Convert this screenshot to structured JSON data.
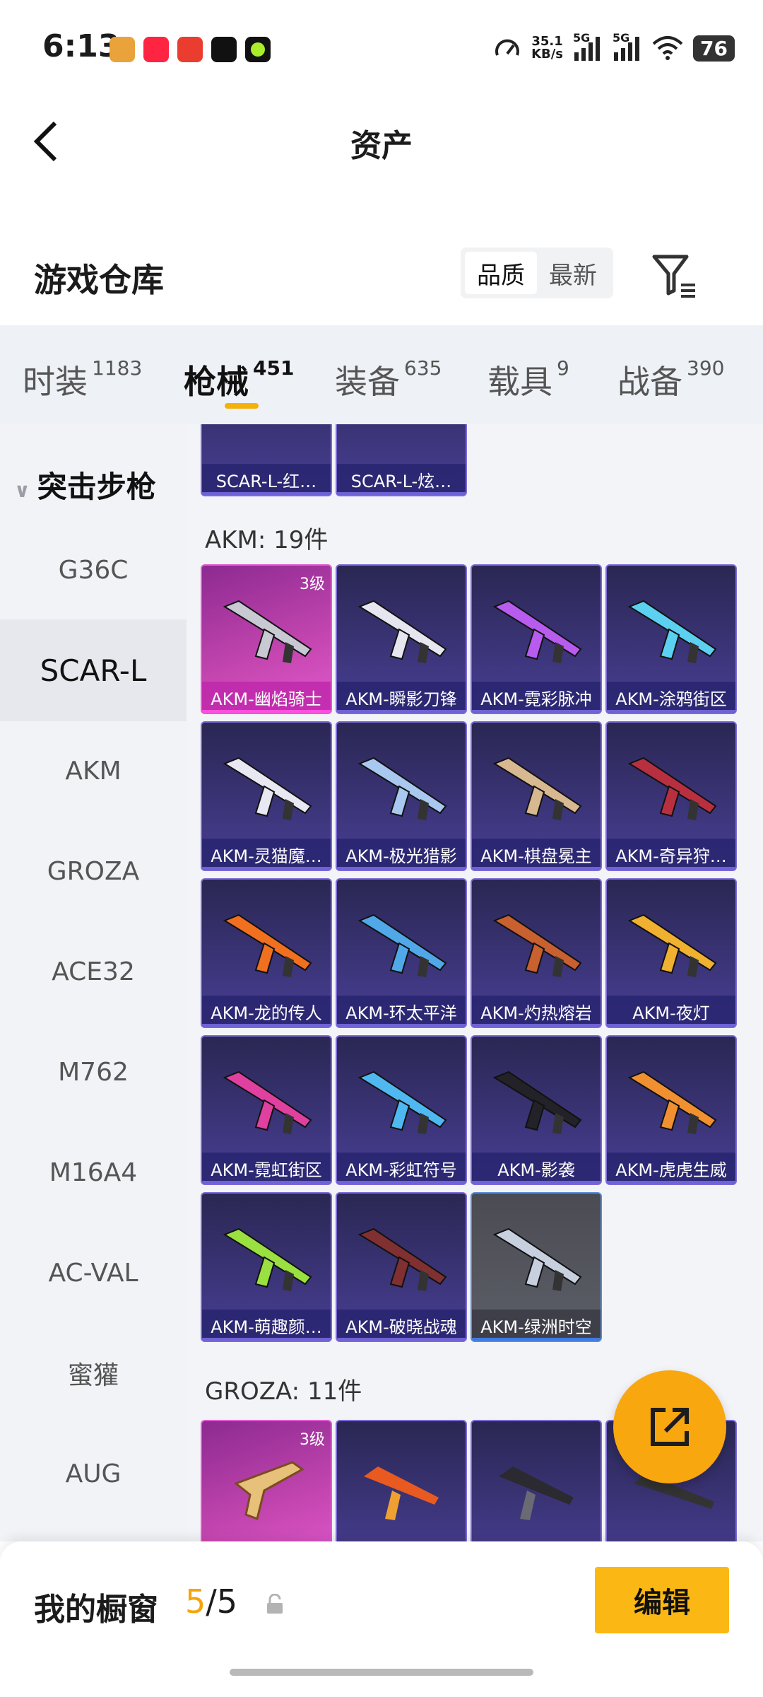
{
  "status_bar": {
    "time": "6:13",
    "speed_value": "35.1",
    "speed_unit": "KB/s",
    "network1": "5G",
    "network2": "5G",
    "battery": "76"
  },
  "header": {
    "title": "资产"
  },
  "section": {
    "title": "游戏仓库",
    "sort_options": [
      "品质",
      "最新"
    ],
    "active_sort": "品质"
  },
  "tabs": [
    {
      "label": "时装",
      "count": "1183"
    },
    {
      "label": "枪械",
      "count": "451"
    },
    {
      "label": "装备",
      "count": "635"
    },
    {
      "label": "载具",
      "count": "9"
    },
    {
      "label": "战备",
      "count": "390"
    }
  ],
  "active_tab": "枪械",
  "sidebar": {
    "group": "突击步枪",
    "items": [
      "G36C",
      "SCAR-L",
      "AKM",
      "GROZA",
      "ACE32",
      "M762",
      "M16A4",
      "AC-VAL",
      "蜜獾",
      "AUG"
    ],
    "active_item": "SCAR-L"
  },
  "content": {
    "scar_partial": [
      "SCAR-L-红…",
      "SCAR-L-炫…"
    ],
    "akm_title": "AKM: 19件",
    "akm_items": [
      {
        "name": "AKM-幽焰骑士",
        "level": "3级",
        "rarity": "legend"
      },
      {
        "name": "AKM-瞬影刀锋",
        "rarity": "epic"
      },
      {
        "name": "AKM-霓彩脉冲",
        "rarity": "epic"
      },
      {
        "name": "AKM-涂鸦街区",
        "rarity": "epic"
      },
      {
        "name": "AKM-灵猫魔…",
        "rarity": "epic"
      },
      {
        "name": "AKM-极光猎影",
        "rarity": "epic"
      },
      {
        "name": "AKM-棋盘冕主",
        "rarity": "epic"
      },
      {
        "name": "AKM-奇异狩…",
        "rarity": "epic"
      },
      {
        "name": "AKM-龙的传人",
        "rarity": "epic"
      },
      {
        "name": "AKM-环太平洋",
        "rarity": "epic"
      },
      {
        "name": "AKM-灼热熔岩",
        "rarity": "epic"
      },
      {
        "name": "AKM-夜灯",
        "rarity": "epic"
      },
      {
        "name": "AKM-霓虹街区",
        "rarity": "epic"
      },
      {
        "name": "AKM-彩虹符号",
        "rarity": "epic"
      },
      {
        "name": "AKM-影袭",
        "rarity": "epic"
      },
      {
        "name": "AKM-虎虎生威",
        "rarity": "epic"
      },
      {
        "name": "AKM-萌趣颜…",
        "rarity": "epic"
      },
      {
        "name": "AKM-破晓战魂",
        "rarity": "epic"
      },
      {
        "name": "AKM-绿洲时空",
        "rarity": "grey"
      }
    ],
    "groza_title": "GROZA: 11件",
    "groza_top_level": "3级"
  },
  "bottom_bar": {
    "label": "我的橱窗",
    "count_current": "5",
    "count_sep": "/",
    "count_total": "5",
    "edit_label": "编辑"
  },
  "colors": {
    "accent": "#f5b00c",
    "epic": "#3c357a",
    "legend": "#c546b0"
  }
}
